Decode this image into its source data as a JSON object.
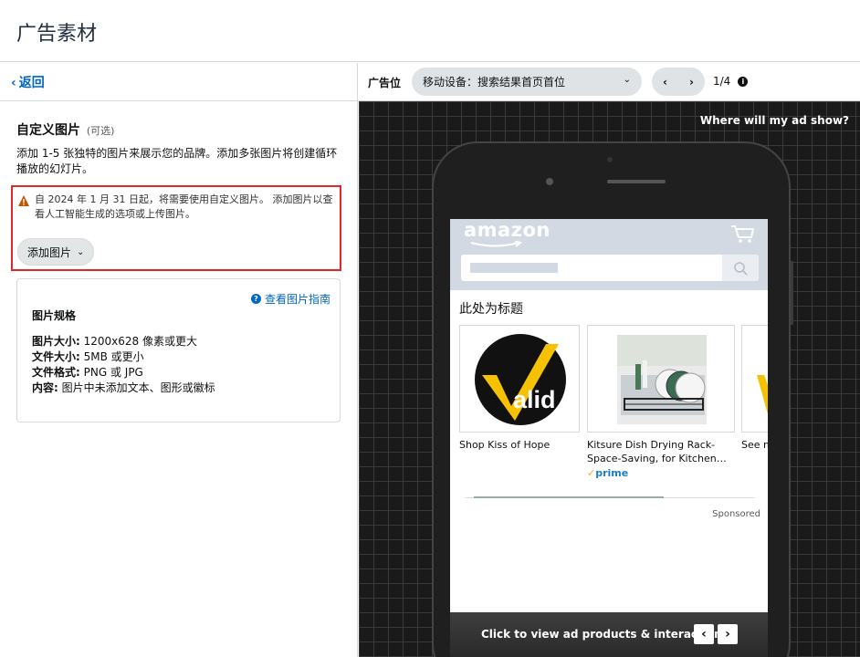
{
  "page": {
    "title": "广告素材"
  },
  "left": {
    "back_label": "返回",
    "section_title": "自定义图片",
    "section_optional": "(可选)",
    "section_desc": "添加 1-5 张独特的图片来展示您的品牌。添加多张图片将创建循环播放的幻灯片。",
    "warning_text": "自 2024 年 1 月 31 日起，将需要使用自定义图片。 添加图片以查看人工智能生成的选项或上传图片。",
    "add_image_label": "添加图片",
    "spec": {
      "guide_link": "查看图片指南",
      "title": "图片规格",
      "rows": [
        {
          "key": "图片大小:",
          "value": "1200x628 像素或更大"
        },
        {
          "key": "文件大小:",
          "value": "5MB 或更小"
        },
        {
          "key": "文件格式:",
          "value": "PNG 或 JPG"
        },
        {
          "key": "内容:",
          "value": "图片中未添加文本、图形或徽标"
        }
      ]
    }
  },
  "preview": {
    "placement_label": "广告位",
    "placement_value": "移动设备：搜索结果首页首位",
    "page_indicator": "1/4",
    "where_label": "Where will my ad show?",
    "amazon_logo": "amazon",
    "headline": "此处为标题",
    "logo_text": "alid",
    "products": [
      {
        "caption": "Shop Kiss of Hope"
      },
      {
        "caption": "Kitsure Dish Drying Rack- Space-Saving, for Kitchen…",
        "prime": "prime"
      },
      {
        "caption": "See m Hope"
      }
    ],
    "sponsored": "Sponsored",
    "cta_text": "Click to view ad products & interaction"
  },
  "colors": {
    "accent": "#0066c0",
    "warning_border": "#e3262a",
    "warning_icon": "#c45500"
  }
}
